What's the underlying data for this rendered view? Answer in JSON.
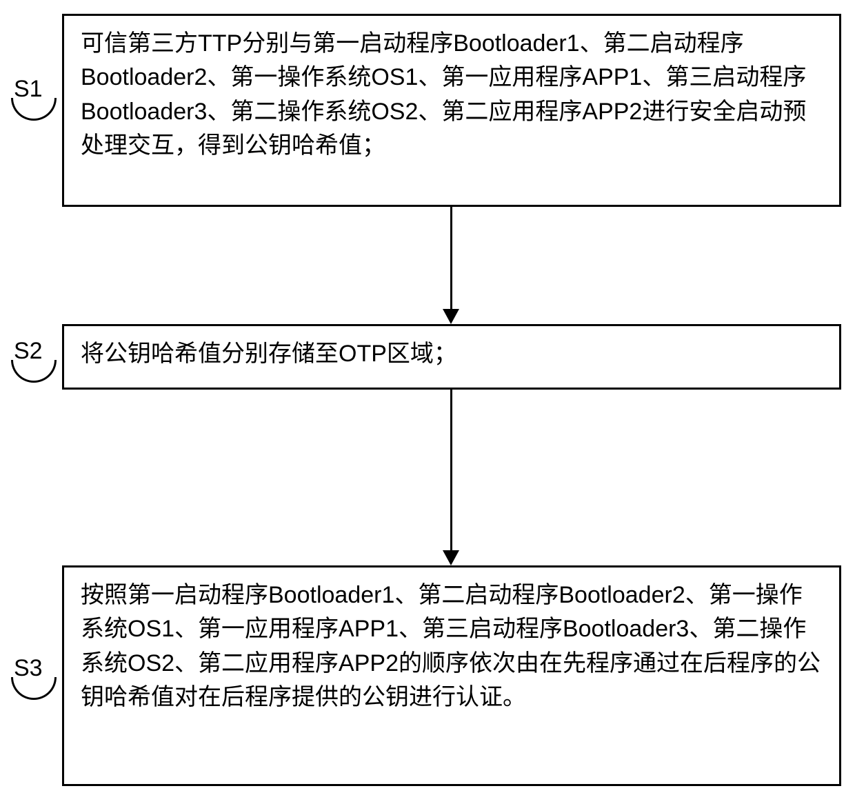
{
  "steps": {
    "s1": {
      "label": "S1",
      "text": "可信第三方TTP分别与第一启动程序Bootloader1、第二启动程序Bootloader2、第一操作系统OS1、第一应用程序APP1、第三启动程序Bootloader3、第二操作系统OS2、第二应用程序APP2进行安全启动预处理交互，得到公钥哈希值；"
    },
    "s2": {
      "label": "S2",
      "text": "将公钥哈希值分别存储至OTP区域；"
    },
    "s3": {
      "label": "S3",
      "text": "按照第一启动程序Bootloader1、第二启动程序Bootloader2、第一操作系统OS1、第一应用程序APP1、第三启动程序Bootloader3、第二操作系统OS2、第二应用程序APP2的顺序依次由在先程序通过在后程序的公钥哈希值对在后程序提供的公钥进行认证。"
    }
  }
}
